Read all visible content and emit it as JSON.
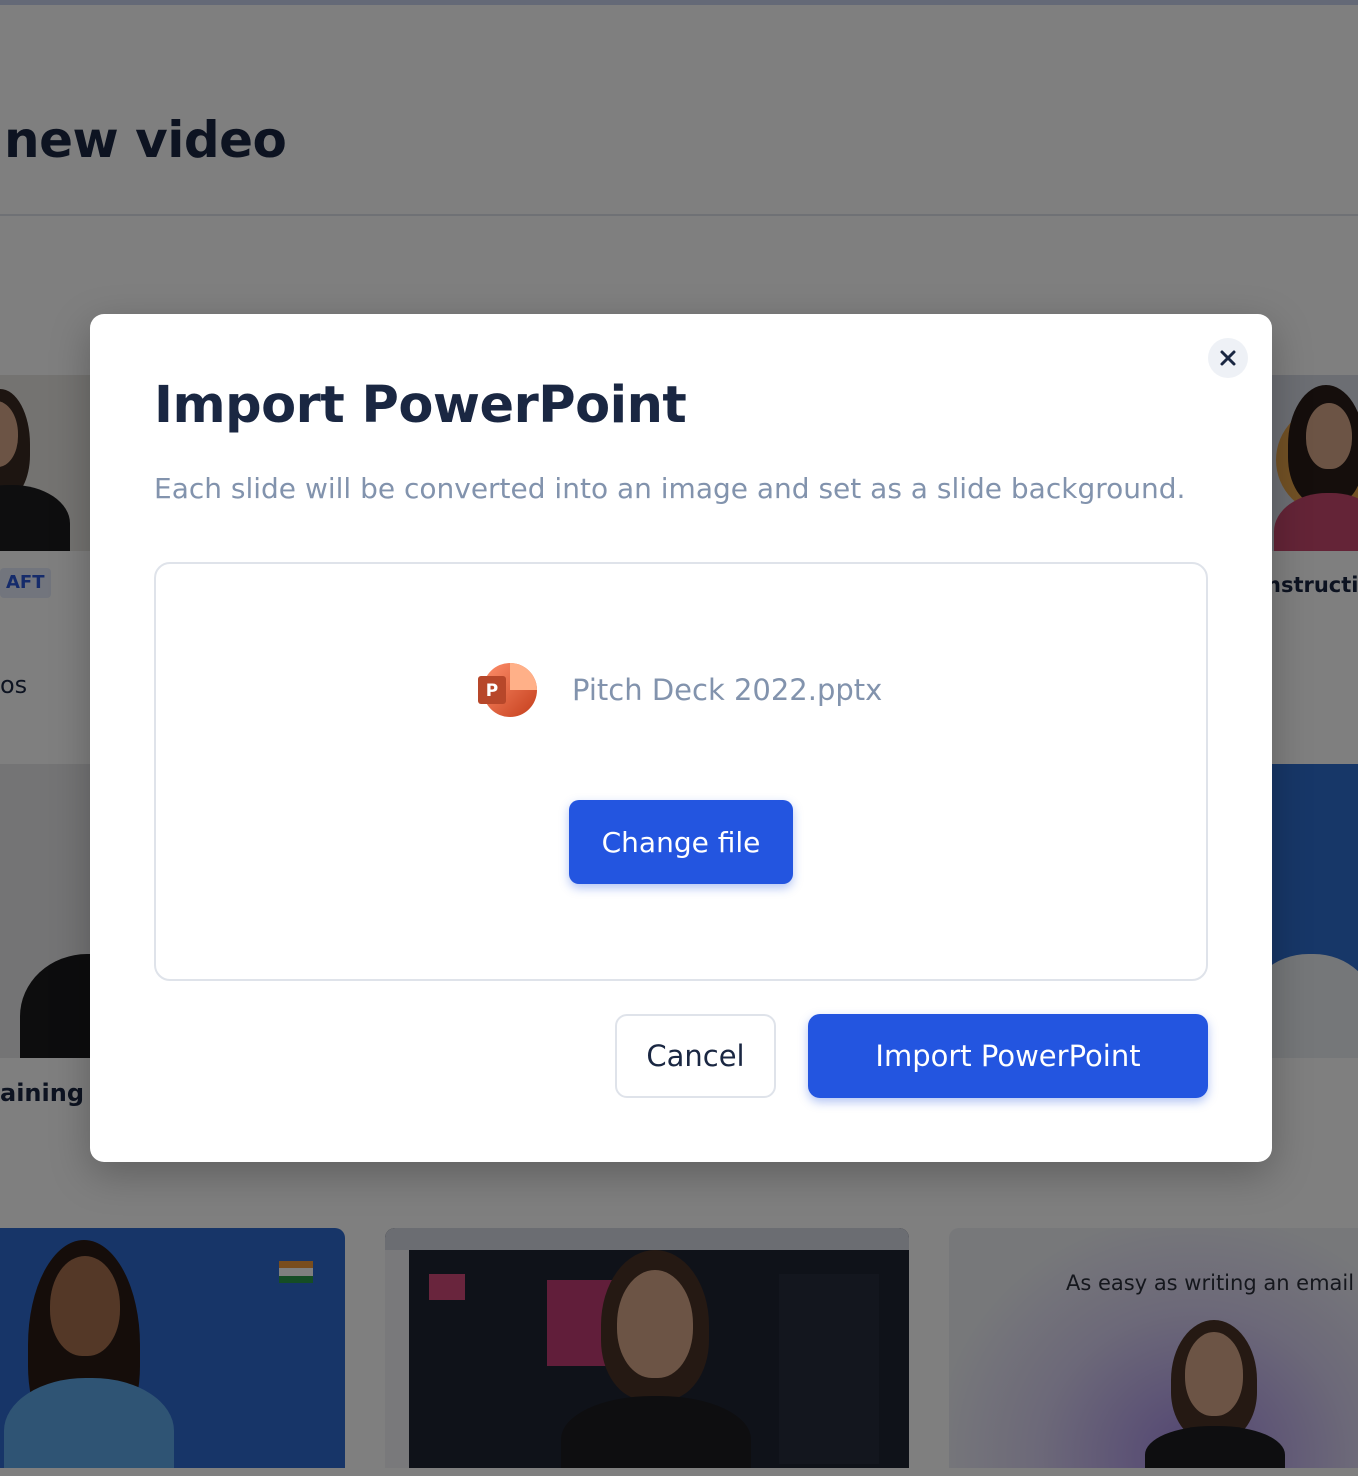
{
  "background_page": {
    "title": "new video",
    "draft_badge": "AFT",
    "card_text_left_1": "os",
    "card_text_left_2": "aining In",
    "card_text_right_1": "nstructio",
    "email_card_caption": "As easy as writing an email"
  },
  "modal": {
    "title": "Import PowerPoint",
    "subtitle": "Each slide will be converted into an image and set as a slide background.",
    "file": {
      "name": "Pitch Deck 2022.pptx",
      "icon": "powerpoint-icon",
      "icon_letter": "P"
    },
    "change_file_label": "Change file",
    "cancel_label": "Cancel",
    "import_label": "Import PowerPoint",
    "close_icon": "close-icon"
  },
  "colors": {
    "primary": "#2355e0",
    "title_text": "#1a2742",
    "muted_text": "#8293ad",
    "border": "#dfe3ea",
    "overlay": "rgba(0,0,0,0.5)",
    "powerpoint_orange": "#d24726"
  }
}
